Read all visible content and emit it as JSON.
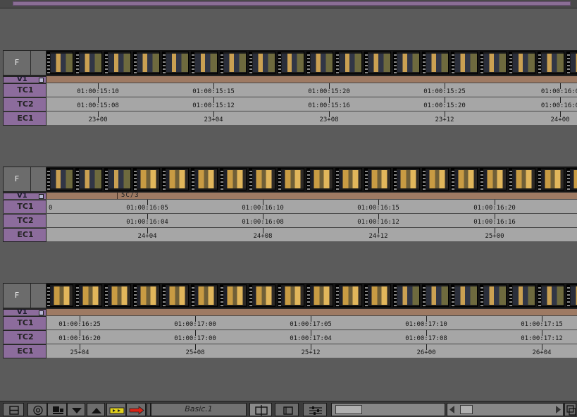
{
  "window": {
    "film_header": "F",
    "track_labels": {
      "video": "V1",
      "tc1": "TC1",
      "tc2": "TC2",
      "ec1": "EC1"
    }
  },
  "bands": [
    {
      "clip_label": "",
      "frames": [
        "dark",
        "dark",
        "dark",
        "dark",
        "dark",
        "dark",
        "dark",
        "dark",
        "dark",
        "dark",
        "dark",
        "dark",
        "dark",
        "dark",
        "dark",
        "dark",
        "dark",
        "dark",
        "dark",
        "dark",
        "dark",
        "dark",
        "dark"
      ],
      "tc1": [
        {
          "text": "01:00:15:10"
        },
        {
          "text": "01:00:15:15"
        },
        {
          "text": "01:00:15:20"
        },
        {
          "text": "01:00:15:25"
        },
        {
          "text": "01:00:16:0"
        }
      ],
      "tc2": [
        {
          "text": "01:00:15:08"
        },
        {
          "text": "01:00:15:12"
        },
        {
          "text": "01:00:15:16"
        },
        {
          "text": "01:00:15:20"
        },
        {
          "text": "01:00:16:0"
        }
      ],
      "ec1": [
        {
          "text": "23+00"
        },
        {
          "text": "23+04"
        },
        {
          "text": "23+08"
        },
        {
          "text": "23+12"
        },
        {
          "text": "24+00"
        }
      ]
    },
    {
      "clip_label": "5C/3",
      "frames": [
        "dark",
        "dark",
        "dark",
        "gold",
        "gold",
        "gold",
        "gold",
        "gold",
        "gold",
        "gold",
        "gold",
        "gold",
        "gold",
        "gold",
        "gold",
        "gold",
        "gold",
        "gold",
        "gold",
        "gold",
        "gold",
        "gold",
        "gold"
      ],
      "tc1": [
        {
          "text": "0"
        },
        {
          "text": "01:00:16:05"
        },
        {
          "text": "01:00:16:10"
        },
        {
          "text": "01:00:16:15"
        },
        {
          "text": "01:00:16:20"
        }
      ],
      "tc2": [
        {
          "text": "01:00:16:04"
        },
        {
          "text": "01:00:16:08"
        },
        {
          "text": "01:00:16:12"
        },
        {
          "text": "01:00:16:16"
        }
      ],
      "ec1": [
        {
          "text": "24+04"
        },
        {
          "text": "24+08"
        },
        {
          "text": "24+12"
        },
        {
          "text": "25+00"
        }
      ]
    },
    {
      "clip_label": "",
      "frames": [
        "gold",
        "gold",
        "gold",
        "gold",
        "gold",
        "gold",
        "gold",
        "gold",
        "gold",
        "gold",
        "gold",
        "gold",
        "dark",
        "dark",
        "dark",
        "dark",
        "dark",
        "dark",
        "dark",
        "dark",
        "dark",
        "dark",
        "dark"
      ],
      "tc1": [
        {
          "text": "01:00:16:25"
        },
        {
          "text": "01:00:17:00"
        },
        {
          "text": "01:00:17:05"
        },
        {
          "text": "01:00:17:10"
        },
        {
          "text": "01:00:17:15"
        }
      ],
      "tc2": [
        {
          "text": "01:00:16:20"
        },
        {
          "text": "01:00:17:00"
        },
        {
          "text": "01:00:17:04"
        },
        {
          "text": "01:00:17:08"
        },
        {
          "text": "01:00:17:12"
        }
      ],
      "ec1": [
        {
          "text": "25+04"
        },
        {
          "text": "25+08"
        },
        {
          "text": "25+12"
        },
        {
          "text": "26+00"
        },
        {
          "text": "26+04"
        }
      ]
    }
  ],
  "toolbar": {
    "preset_label": "Basic.1",
    "buttons": [
      {
        "icon": "stack-view-icon"
      },
      {
        "icon": "target-icon"
      },
      {
        "icon": "monitor-icon"
      },
      {
        "icon": "triangle-down-icon"
      },
      {
        "icon": "triangle-up-icon"
      },
      {
        "icon": "yellow-arrow-icon"
      },
      {
        "icon": "red-arrow-icon"
      },
      {
        "icon": "split-view-icon"
      },
      {
        "icon": "frame-icon"
      },
      {
        "icon": "sliders-icon"
      }
    ]
  },
  "colors": {
    "track_header": "#8c6c9c",
    "video_track": "#9e7a63",
    "timecode_track": "#a6a6a6",
    "window_bg": "#5b5b5b",
    "yellow_button": "#e2d21c",
    "red_button": "#d92416"
  }
}
